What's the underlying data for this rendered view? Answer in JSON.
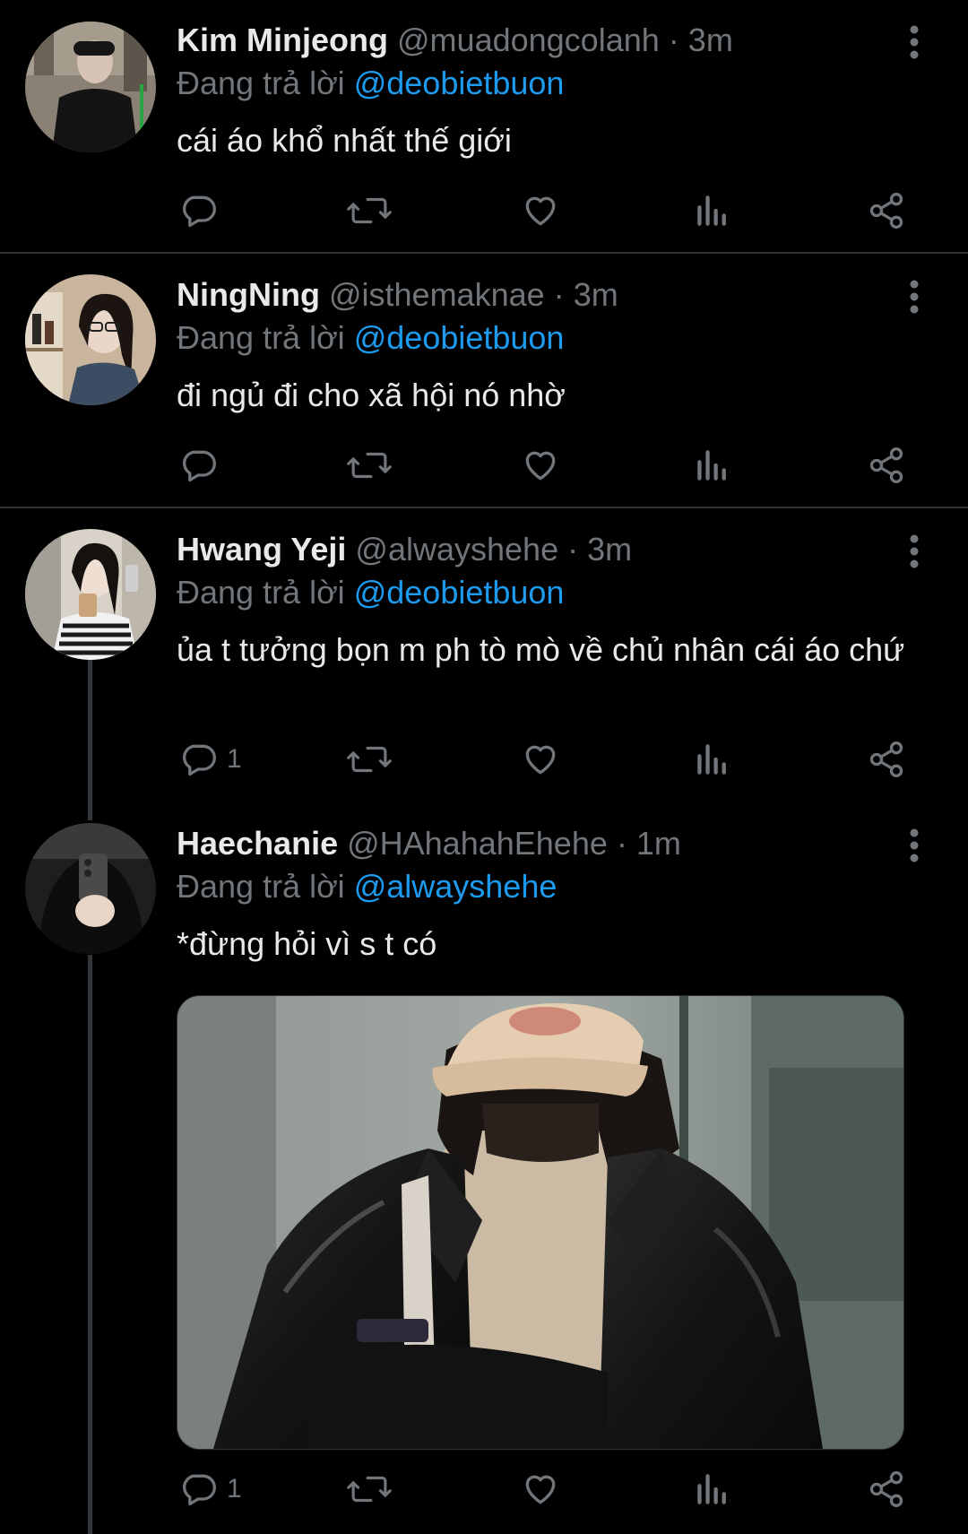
{
  "tweets": [
    {
      "name": "Kim Minjeong",
      "handle": "@muadongcolanh",
      "sep": "·",
      "time": "3m",
      "replying_prefix": "Đang trả lời",
      "replying_to": "@deobietbuon",
      "text": "cái áo khổ nhất thế giới",
      "reply_count": ""
    },
    {
      "name": "NingNing",
      "handle": "@isthemaknae",
      "sep": "·",
      "time": "3m",
      "replying_prefix": "Đang trả lời",
      "replying_to": "@deobietbuon",
      "text": "đi ngủ đi cho xã hội nó nhờ",
      "reply_count": ""
    },
    {
      "name": "Hwang Yeji",
      "handle": "@alwayshehe",
      "sep": "·",
      "time": "3m",
      "replying_prefix": "Đang trả lời",
      "replying_to": "@deobietbuon",
      "text": "ủa t tưởng bọn m ph tò mò về chủ nhân cái áo chứ",
      "reply_count": "1"
    },
    {
      "name": "Haechanie",
      "handle": "@HAhahahEhehe",
      "sep": "·",
      "time": "1m",
      "replying_prefix": "Đang trả lời",
      "replying_to": "@alwayshehe",
      "text": "*đừng hỏi vì s t có",
      "reply_count": "1"
    }
  ],
  "icons": {
    "reply": "reply-icon",
    "retweet": "retweet-icon",
    "like": "heart-icon",
    "views": "bar-chart-icon",
    "share": "share-icon",
    "more": "more-vertical-icon"
  },
  "colors": {
    "background": "#000000",
    "text": "#e7e9ea",
    "secondary": "#71767b",
    "mention": "#1d9bf0",
    "divider": "#2f3336"
  }
}
